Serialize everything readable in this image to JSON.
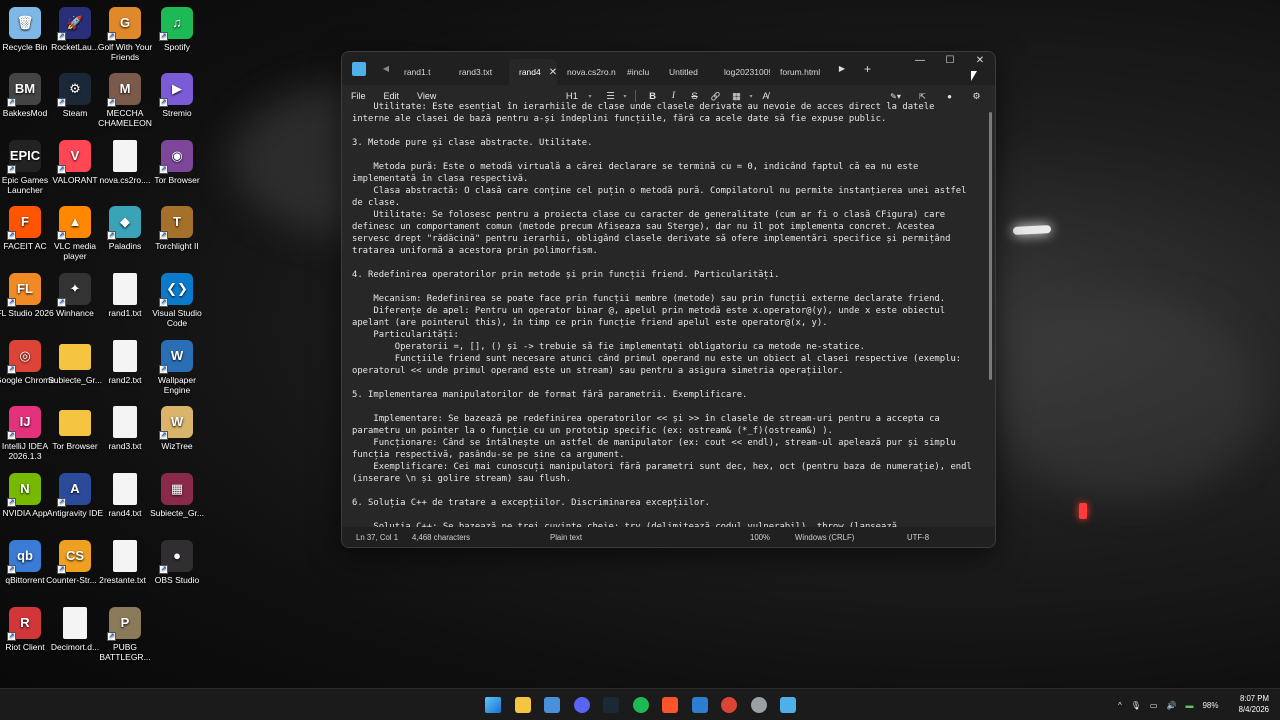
{
  "desktop": {
    "icons": [
      {
        "label": "Recycle Bin",
        "glyph": "🗑",
        "color": "#7fb8e6",
        "shortcut": false
      },
      {
        "label": "RocketLau...",
        "glyph": "🚀",
        "color": "#2a2f7a",
        "shortcut": true
      },
      {
        "label": "Golf With Your Friends",
        "glyph": "G",
        "color": "#e0892a",
        "shortcut": true
      },
      {
        "label": "Spotify",
        "glyph": "♫",
        "color": "#1db954",
        "shortcut": true
      },
      {
        "label": "BakkesMod",
        "glyph": "BM",
        "color": "#444444",
        "shortcut": true
      },
      {
        "label": "Steam",
        "glyph": "⚙",
        "color": "#1b2838",
        "shortcut": true
      },
      {
        "label": "MECCHA CHAMELEON",
        "glyph": "M",
        "color": "#7a5a4a",
        "shortcut": true
      },
      {
        "label": "Stremio",
        "glyph": "▶",
        "color": "#7b5bd6",
        "shortcut": true
      },
      {
        "label": "Epic Games Launcher",
        "glyph": "EPIC",
        "color": "#222222",
        "shortcut": true
      },
      {
        "label": "VALORANT",
        "glyph": "V",
        "color": "#ff4655",
        "shortcut": true
      },
      {
        "label": "nova.cs2ro....",
        "glyph": "",
        "color": "#f4f4f4",
        "shortcut": false
      },
      {
        "label": "Tor Browser",
        "glyph": "◉",
        "color": "#7d4698",
        "shortcut": true
      },
      {
        "label": "FACEIT AC",
        "glyph": "F",
        "color": "#ff5500",
        "shortcut": true
      },
      {
        "label": "VLC media player",
        "glyph": "▲",
        "color": "#ff8800",
        "shortcut": true
      },
      {
        "label": "Paladins",
        "glyph": "◆",
        "color": "#3aa3b8",
        "shortcut": true
      },
      {
        "label": "Torchlight II",
        "glyph": "T",
        "color": "#a5702a",
        "shortcut": true
      },
      {
        "label": "FL Studio 2026",
        "glyph": "FL",
        "color": "#f08a24",
        "shortcut": true
      },
      {
        "label": "Winhance",
        "glyph": "✦",
        "color": "#333333",
        "shortcut": true
      },
      {
        "label": "rand1.txt",
        "glyph": "",
        "color": "#f4f4f4",
        "shortcut": false
      },
      {
        "label": "Visual Studio Code",
        "glyph": "❮❯",
        "color": "#0a7acc",
        "shortcut": true
      },
      {
        "label": "Google Chrome",
        "glyph": "◎",
        "color": "#db4437",
        "shortcut": true
      },
      {
        "label": "Subiecte_Gr...",
        "glyph": "",
        "color": "#f5c542",
        "shortcut": false
      },
      {
        "label": "rand2.txt",
        "glyph": "",
        "color": "#f4f4f4",
        "shortcut": false
      },
      {
        "label": "Wallpaper Engine",
        "glyph": "W",
        "color": "#2a6fb5",
        "shortcut": true
      },
      {
        "label": "IntelliJ IDEA 2026.1.3",
        "glyph": "IJ",
        "color": "#e3317b",
        "shortcut": true
      },
      {
        "label": "Tor Browser",
        "glyph": "",
        "color": "#f5c542",
        "shortcut": false
      },
      {
        "label": "rand3.txt",
        "glyph": "",
        "color": "#f4f4f4",
        "shortcut": false
      },
      {
        "label": "WizTree",
        "glyph": "W",
        "color": "#d9b46a",
        "shortcut": true
      },
      {
        "label": "NVIDIA App",
        "glyph": "N",
        "color": "#76b900",
        "shortcut": true
      },
      {
        "label": "Antigravity IDE",
        "glyph": "A",
        "color": "#2b4a9a",
        "shortcut": true
      },
      {
        "label": "rand4.txt",
        "glyph": "",
        "color": "#f4f4f4",
        "shortcut": false
      },
      {
        "label": "Subiecte_Gr...",
        "glyph": "▦",
        "color": "#8a2a4a",
        "shortcut": false
      },
      {
        "label": "qBittorrent",
        "glyph": "qb",
        "color": "#3a7bd5",
        "shortcut": true
      },
      {
        "label": "Counter-Str... 2",
        "glyph": "CS",
        "color": "#f0a020",
        "shortcut": true
      },
      {
        "label": "restante.txt",
        "glyph": "",
        "color": "#f4f4f4",
        "shortcut": false
      },
      {
        "label": "OBS Studio",
        "glyph": "●",
        "color": "#302e31",
        "shortcut": true
      },
      {
        "label": "Riot Client",
        "glyph": "R",
        "color": "#d13639",
        "shortcut": true
      },
      {
        "label": "Decimort.d...",
        "glyph": "",
        "color": "#f4f4f4",
        "shortcut": false
      },
      {
        "label": "PUBG BATTLEGR...",
        "glyph": "P",
        "color": "#8a7a5a",
        "shortcut": true
      }
    ]
  },
  "window": {
    "tabs": [
      {
        "label": "rand1.t",
        "active": false,
        "dot": false
      },
      {
        "label": "rand3.txt",
        "active": false,
        "dot": false
      },
      {
        "label": "rand4",
        "active": true,
        "dot": false
      },
      {
        "label": "nova.cs2ro.n",
        "active": false,
        "dot": false
      },
      {
        "label": "#inclu",
        "active": false,
        "dot": true
      },
      {
        "label": "Untitled",
        "active": false,
        "dot": false
      },
      {
        "label": "log20231009",
        "active": false,
        "dot": false
      },
      {
        "label": "forum.html",
        "active": false,
        "dot": false
      }
    ],
    "tab_close": "✕",
    "add_tab": "+",
    "scroll_right": "▶",
    "scroll_left": "◀",
    "controls": {
      "minimize": "—",
      "maximize": "☐",
      "close": "✕"
    },
    "menu": {
      "file": "File",
      "edit": "Edit",
      "view": "View"
    },
    "toolbar": {
      "heading": "H1",
      "list": "☰",
      "bold": "B",
      "italic": "I",
      "strike": "S",
      "link": "🔗",
      "table": "▦",
      "clear": "A̸"
    },
    "lines": [
      "    Utilitate: Este esențial în ierarhiile de clase unde clasele derivate au nevoie de acces direct la datele interne ale clasei de bază pentru a-și îndeplini funcțiile, fără ca acele date să fie expuse public.",
      "",
      "3. Metode pure și clase abstracte. Utilitate.",
      "",
      "    Metoda pură: Este o metodă virtuală a cărei declarare se termină cu = 0, indicând faptul că ea nu este implementată în clasa respectivă.",
      "    Clasa abstractă: O clasă care conține cel puțin o metodă pură. Compilatorul nu permite instanțierea unei astfel de clase.",
      "    Utilitate: Se folosesc pentru a proiecta clase cu caracter de generalitate (cum ar fi o clasă CFigura) care definesc un comportament comun (metode precum Afiseaza sau Sterge), dar nu îl pot implementa concret. Acestea servesc drept \"rădăcină\" pentru ierarhii, obligând clasele derivate să ofere implementări specifice și permițând tratarea uniformă a acestora prin polimorfism.",
      "",
      "4. Redefinirea operatorilor prin metode și prin funcții friend. Particularități.",
      "",
      "    Mecanism: Redefinirea se poate face prin funcții membre (metode) sau prin funcții externe declarate friend.",
      "    Diferențe de apel: Pentru un operator binar @, apelul prin metodă este x.operator@(y), unde x este obiectul apelant (are pointerul this), în timp ce prin funcție friend apelul este operator@(x, y).",
      "    Particularități:",
      "        Operatorii =, [], () și -> trebuie să fie implementați obligatoriu ca metode ne-statice.",
      "        Funcțiile friend sunt necesare atunci când primul operand nu este un obiect al clasei respective (exemplu: operatorul << unde primul operand este un stream) sau pentru a asigura simetria operațiilor.",
      "",
      "5. Implementarea manipulatorilor de format fără parametrii. Exemplificare.",
      "",
      "    Implementare: Se bazează pe redefinirea operatorilor << și >> în clasele de stream-uri pentru a accepta ca parametru un pointer la o funcție cu un prototip specific (ex: ostream& (*_f)(ostream&) ).",
      "    Funcționare: Când se întâlnește un astfel de manipulator (ex: cout << endl), stream-ul apelează pur și simplu funcția respectivă, pasându-se pe sine ca argument.",
      "    Exemplificare: Cei mai cunoscuți manipulatori fără parametri sunt dec, hex, oct (pentru baza de numerație), endl (inserare \\n și golire stream) sau flush.",
      "",
      "6. Soluția C++ de tratare a excepțiilor. Discriminarea excepțiilor.",
      "",
      "    Soluția C++: Se bazează pe trei cuvinte cheie: try (delimitează codul vulnerabil), throw (lansează"
    ],
    "status": {
      "position": "Ln 37, Col 1",
      "chars": "4,468 characters",
      "format": "Plain text",
      "zoom": "100%",
      "line_ending": "Windows (CRLF)",
      "encoding": "UTF-8"
    }
  },
  "taskbar": {
    "apps": [
      {
        "name": "start-icon",
        "color": "#3ea6ff"
      },
      {
        "name": "file-explorer-icon",
        "color": "#f5c542"
      },
      {
        "name": "photos-icon",
        "color": "#4a90d9"
      },
      {
        "name": "discord-icon",
        "color": "#5865f2"
      },
      {
        "name": "steam-icon",
        "color": "#1b2838"
      },
      {
        "name": "spotify-icon",
        "color": "#1db954"
      },
      {
        "name": "brave-icon",
        "color": "#fb542b"
      },
      {
        "name": "remote-desktop-icon",
        "color": "#2d7dd2"
      },
      {
        "name": "chrome-icon",
        "color": "#db4437"
      },
      {
        "name": "settings-icon",
        "color": "#9aa0a6"
      },
      {
        "name": "notepad-icon",
        "color": "#4fb0e9"
      }
    ],
    "battery": "98%",
    "time": "8:07 PM",
    "date": "8/4/2026",
    "chevron": "^"
  }
}
